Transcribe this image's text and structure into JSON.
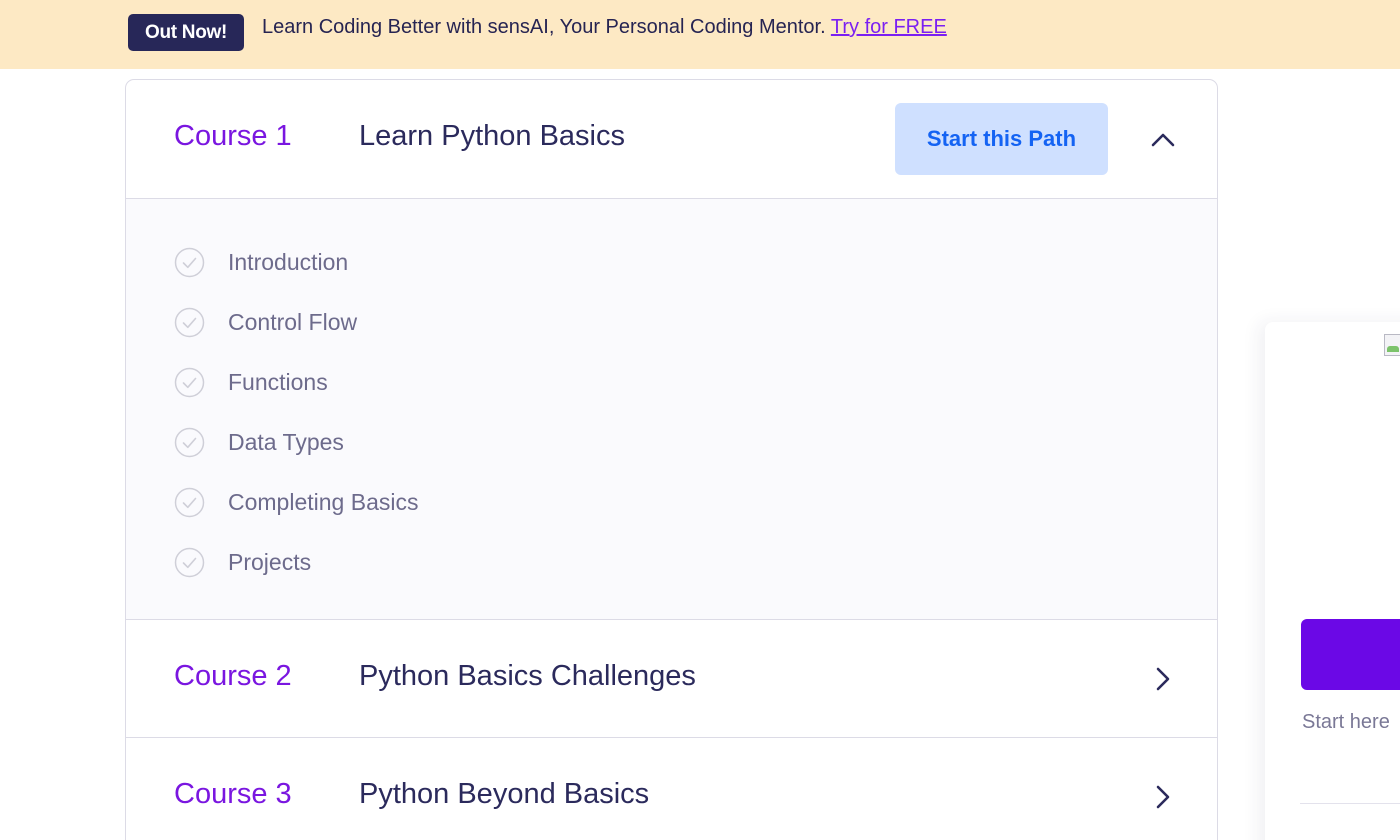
{
  "banner": {
    "badge": "Out Now!",
    "text": "Learn Coding Better with sensAI, Your Personal Coding Mentor.",
    "link": "Try for FREE"
  },
  "courses": [
    {
      "number": "Course 1",
      "title": "Learn Python Basics",
      "action": "Start this Path",
      "expanded": true,
      "toggle_icon": "chevron-up-icon",
      "lessons": [
        "Introduction",
        "Control Flow",
        "Functions",
        "Data Types",
        "Completing Basics",
        "Projects"
      ]
    },
    {
      "number": "Course 2",
      "title": "Python Basics Challenges",
      "expanded": false,
      "toggle_icon": "chevron-right-icon"
    },
    {
      "number": "Course 3",
      "title": "Python Beyond Basics",
      "expanded": false,
      "toggle_icon": "chevron-right-icon"
    }
  ],
  "side_card": {
    "note": "Start here",
    "image_icon": "broken-image-icon"
  },
  "colors": {
    "banner_bg": "#fde9c4",
    "badge_bg": "#272758",
    "accent_purple": "#7a16e0",
    "link_purple": "#7b1ff2",
    "start_button_bg": "#cfe0ff",
    "start_button_text": "#1463f3",
    "side_button_bg": "#6b08e6"
  }
}
